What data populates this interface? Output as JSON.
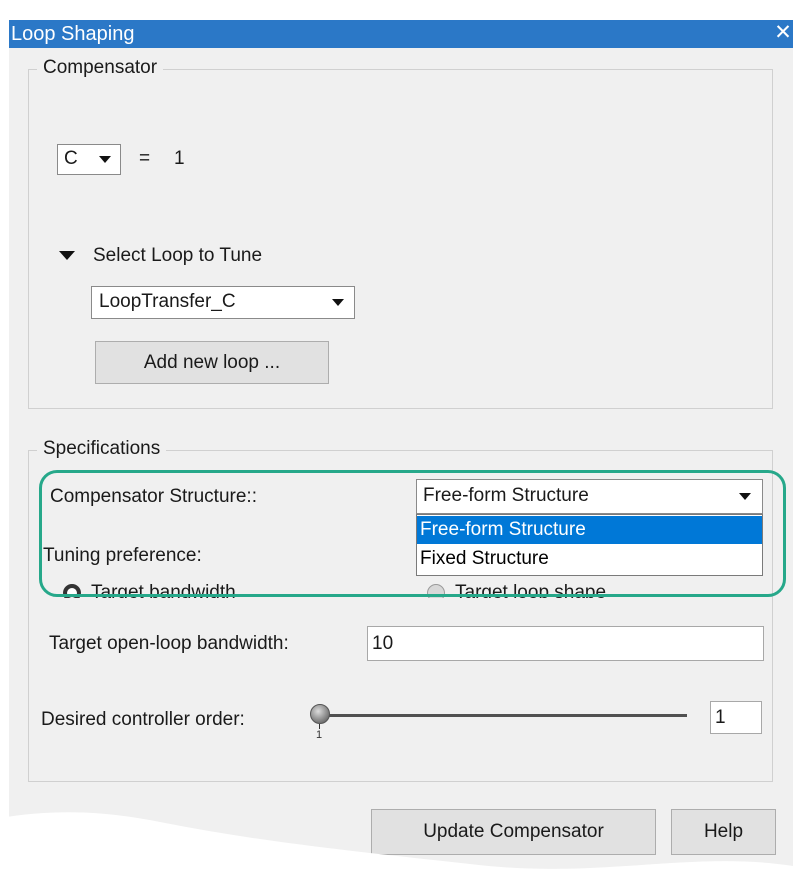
{
  "window": {
    "title": "Loop Shaping",
    "close_glyph": "✕"
  },
  "compensator": {
    "legend": "Compensator",
    "selector_value": "C",
    "equals": "=",
    "value": "1",
    "select_loop_label": "Select Loop to Tune",
    "loop_dropdown_value": "LoopTransfer_C",
    "add_loop_button": "Add new loop ..."
  },
  "specifications": {
    "legend": "Specifications",
    "structure_label": "Compensator Structure::",
    "structure_value": "Free-form Structure",
    "structure_options": [
      "Free-form Structure",
      "Fixed Structure"
    ],
    "selected_option_index": 0,
    "tuning_label": "Tuning preference:",
    "radio_bandwidth_label": "Target bandwidth",
    "radio_loopshape_label": "Target loop shape",
    "bandwidth_label": "Target open-loop bandwidth:",
    "bandwidth_value": "10",
    "order_label": "Desired controller order:",
    "slider_tick": "1",
    "order_value": "1"
  },
  "footer": {
    "update_button": "Update Compensator",
    "help_button": "Help"
  },
  "colors": {
    "title_bar": "#2b78c7",
    "highlight": "#26a88a",
    "selected_option": "#0078d7"
  }
}
